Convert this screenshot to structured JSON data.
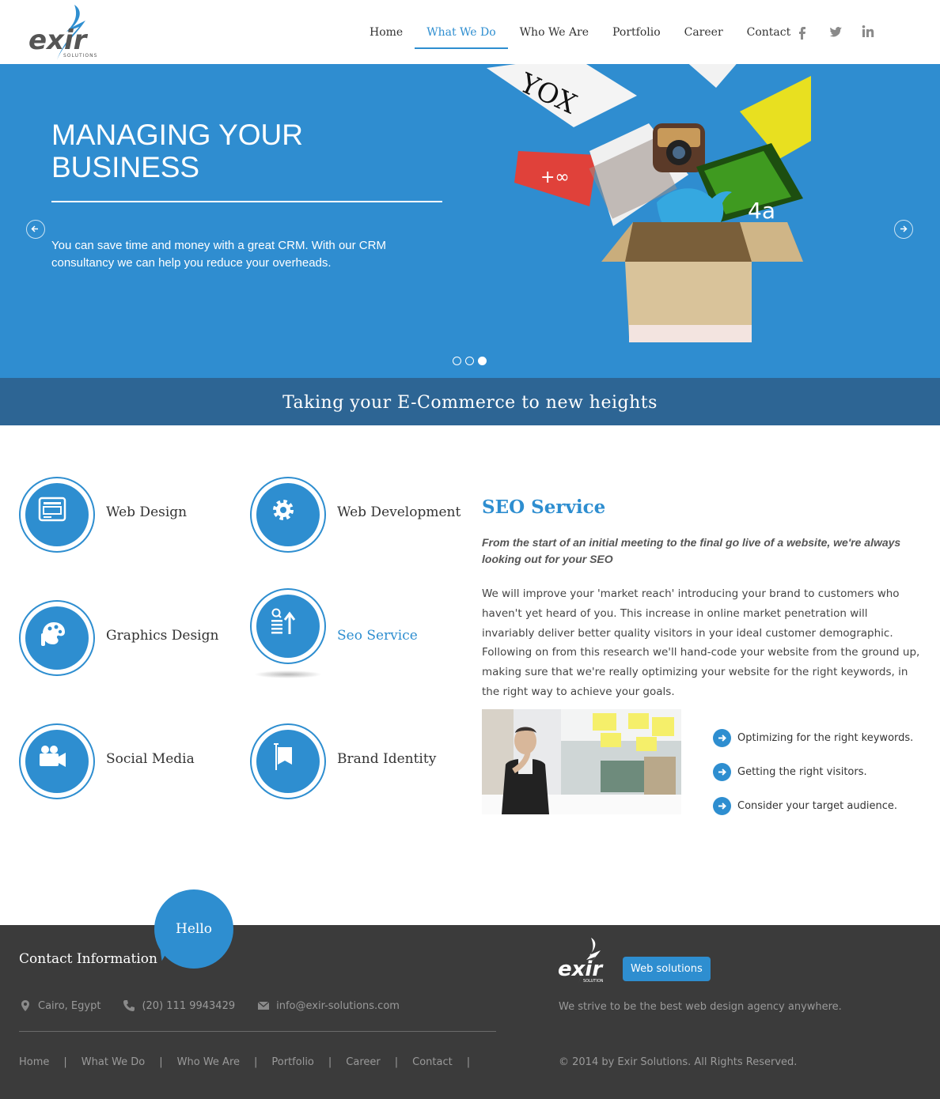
{
  "header": {
    "logo_text": "exir",
    "logo_sub": "SOLUTIONS",
    "nav": [
      {
        "label": "Home",
        "active": false
      },
      {
        "label": "What We Do",
        "active": true
      },
      {
        "label": "Who We Are",
        "active": false
      },
      {
        "label": "Portfolio",
        "active": false
      },
      {
        "label": "Career",
        "active": false
      },
      {
        "label": "Contact",
        "active": false
      }
    ],
    "social": [
      "facebook-icon",
      "twitter-icon",
      "linkedin-icon"
    ]
  },
  "hero": {
    "title": "MANAGING YOUR BUSINESS",
    "text": "You can save time and money with a great CRM. With our CRM consultancy we can help you reduce your overheads.",
    "slides": 3,
    "active_slide": 3
  },
  "banner": {
    "text": "Taking your E-Commerce to new heights"
  },
  "services": [
    {
      "label": "Web Design",
      "icon": "web-design-icon"
    },
    {
      "label": "Web Development",
      "icon": "gear-icon"
    },
    {
      "label": "Graphics Design",
      "icon": "palette-icon"
    },
    {
      "label": "Seo Service",
      "icon": "seo-icon",
      "active": true
    },
    {
      "label": "Social Media",
      "icon": "video-camera-icon"
    },
    {
      "label": "Brand Identity",
      "icon": "flag-icon"
    }
  ],
  "seo": {
    "title": "SEO Service",
    "lead": "From the start of an initial meeting to the final go live of a website, we're always looking out for your SEO",
    "body": "We will improve your 'market reach' introducing your brand to customers who haven't yet heard of you. This increase in online market penetration will invariably deliver better quality visitors in your ideal customer demographic. Following on from this research we'll hand-code your website from the ground up, making sure that we're really optimizing your website for the right keywords, in the right way to achieve your goals.",
    "bullets": [
      "Optimizing for the right keywords.",
      "Getting the right visitors.",
      "Consider your target audience."
    ]
  },
  "footer": {
    "hello": "Hello",
    "contact_title": "Contact Information",
    "location": "Cairo, Egypt",
    "phone": "(20) 111 9943429",
    "email": "info@exir-solutions.com",
    "nav": [
      "Home",
      "What We Do",
      "Who We Are",
      "Portfolio",
      "Career",
      "Contact"
    ],
    "separator": "|",
    "badge": "Web solutions",
    "tagline": "We strive to be the best web design agency anywhere.",
    "copyright": "© 2014 by Exir Solutions. All Rights Reserved."
  },
  "colors": {
    "accent": "#2e8ed0",
    "banner": "#2d6594",
    "footer": "#3b3b3b"
  }
}
